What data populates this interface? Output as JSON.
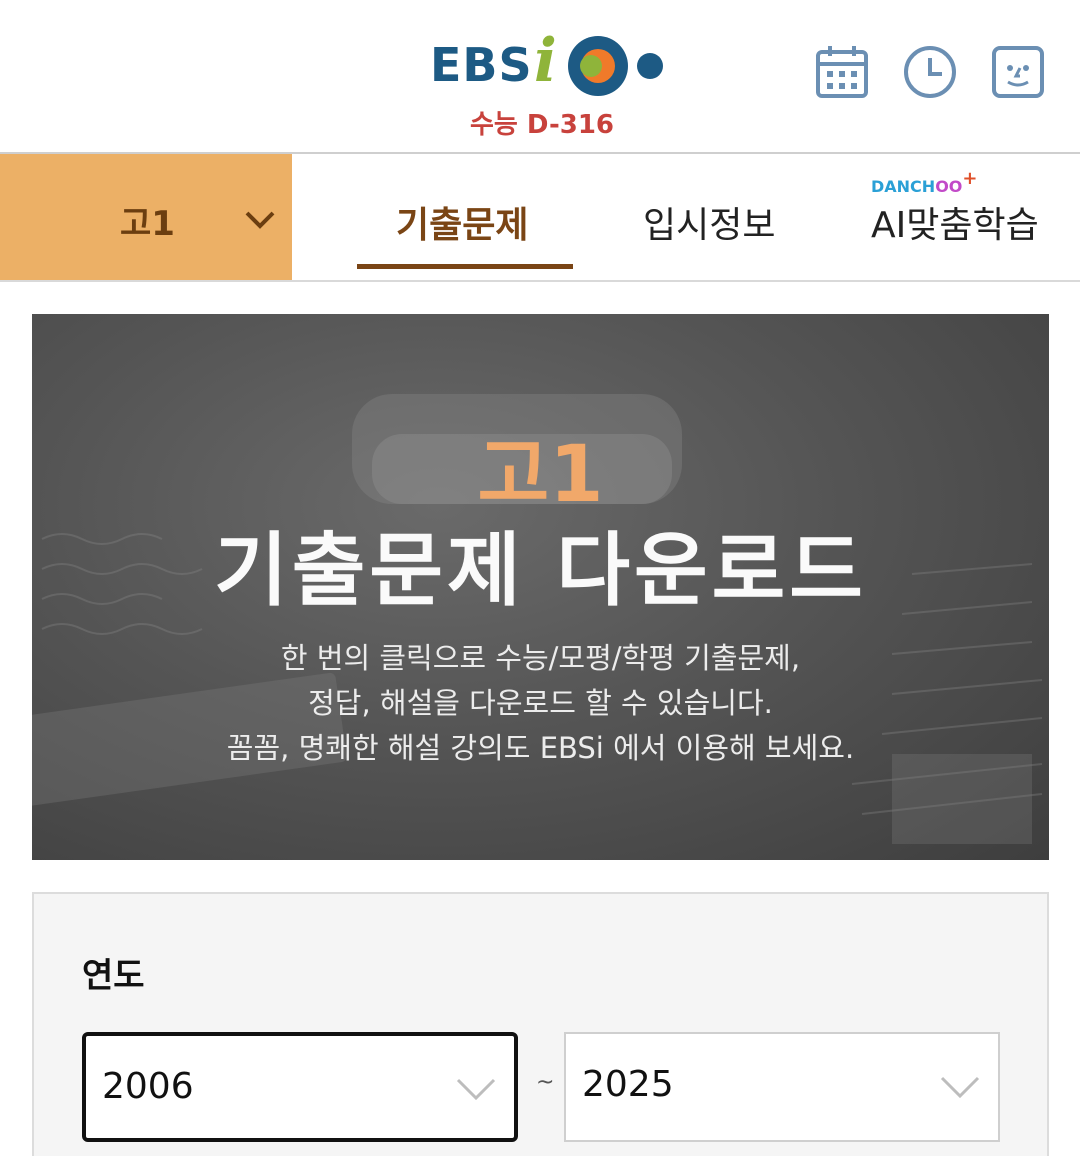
{
  "header": {
    "logo_text": "EBS",
    "logo_i": "i",
    "dday": "수능 D-316",
    "icons": [
      "calendar-icon",
      "clock-icon",
      "my-face-icon"
    ]
  },
  "nav": {
    "grade": "고1",
    "tabs": [
      {
        "label": "기출문제",
        "active": true
      },
      {
        "label": "입시정보",
        "active": false
      },
      {
        "label": "AI맞춤학습",
        "active": false
      }
    ],
    "danchoo_a": "DANCH",
    "danchoo_b": "OO",
    "danchoo_plus": "+"
  },
  "banner": {
    "grade": "고1",
    "title": "기출문제 다운로드",
    "desc_line1": "한 번의 클릭으로 수능/모평/학평 기출문제,",
    "desc_line2": "정답, 해설을 다운로드 할 수 있습니다.",
    "desc_line3": "꼼꼼, 명쾌한 해설 강의도 EBSi 에서 이용해 보세요."
  },
  "filter": {
    "year_label": "연도",
    "from_year": "2006",
    "separator": "~",
    "to_year": "2025"
  },
  "colors": {
    "brand_blue": "#1d5a84",
    "grade_bg": "#ecb066",
    "active_tab": "#7a4515",
    "dday_red": "#c8423c",
    "banner_accent": "#f1a86a"
  }
}
